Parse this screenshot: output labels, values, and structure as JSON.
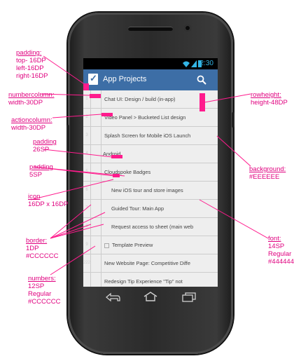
{
  "colors": {
    "accent_pink": "#ff1b8d",
    "annotation_text": "#e0007f",
    "appbar_bg": "#3d6ea6",
    "row_bg": "#EEEEEE",
    "border": "#CCCCCC",
    "font_color": "#444444",
    "status_accent": "#33b5e5"
  },
  "statusbar": {
    "time": "2:30"
  },
  "appbar": {
    "title": "App Projects",
    "logo_icon": "smartsheet-logo-icon",
    "search_icon": "search-icon"
  },
  "rows": [
    {
      "num": "1",
      "text": "Chat UI: Design / build (in-app)"
    },
    {
      "num": "2",
      "text": "Video Panel > Bucketed List design"
    },
    {
      "num": "3",
      "text": "Splash Screen for Mobile iOS Launch"
    },
    {
      "num": "4",
      "text": "Android"
    },
    {
      "num": "5",
      "text": "Cloudspoke Badges"
    },
    {
      "num": "6",
      "text": "New iOS tour and store images"
    },
    {
      "num": "7",
      "text": "Guided Tour: Main App"
    },
    {
      "num": "8",
      "text": "Request access to sheet (main web"
    },
    {
      "num": "9",
      "text": "Template Preview"
    },
    {
      "num": "222",
      "text": "New Website Page: Competitive Diffe"
    },
    {
      "num": "",
      "text": "Redesign Tip Experience \"Tip\" not"
    }
  ],
  "annotations": {
    "padding1": {
      "title": "padding:",
      "lines": [
        "top- 16DP",
        "left-16DP",
        "right-16DP"
      ]
    },
    "numbercolumn": {
      "title": "numbercolumn:",
      "lines": [
        "width-30DP"
      ]
    },
    "actioncolumn": {
      "title": "actioncolumn:",
      "lines": [
        "width-30DP"
      ]
    },
    "padding2": {
      "title": "padding",
      "lines": [
        "26SP"
      ]
    },
    "padding3": {
      "title": "padding",
      "lines": [
        "5SP"
      ]
    },
    "icon": {
      "title": "icon",
      "lines": [
        "16DP x 16DP"
      ]
    },
    "border": {
      "title": "border:",
      "lines": [
        "1DP",
        "#CCCCCC"
      ]
    },
    "numbers": {
      "title": "numbers:",
      "lines": [
        "12SP",
        "Regular",
        "#CCCCCC"
      ]
    },
    "rowheight": {
      "title": "rowheight:",
      "lines": [
        "height-48DP"
      ]
    },
    "background": {
      "title": "background:",
      "lines": [
        "#EEEEEE"
      ]
    },
    "font": {
      "title": "font:",
      "lines": [
        "14SP",
        "Regular",
        "#444444"
      ]
    }
  },
  "nav": {
    "back_icon": "back-icon",
    "home_icon": "home-icon",
    "recents_icon": "recents-icon"
  }
}
